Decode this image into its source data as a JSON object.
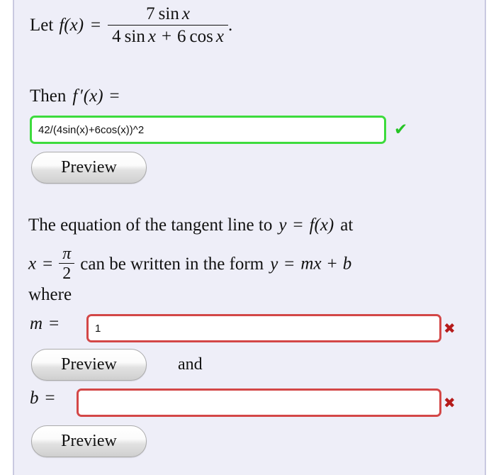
{
  "problem": {
    "intro_lead": "Let",
    "function_name": "f(x)",
    "equals": "=",
    "numerator_coefficient": "7",
    "numerator_func": "sin",
    "numerator_var": "x",
    "denominator": "4 sin x + 6 cos x",
    "den_c1": "4",
    "den_f1": "sin",
    "den_v1": "x",
    "den_plus": "+",
    "den_c2": "6",
    "den_f2": "cos",
    "den_v2": "x",
    "period": "."
  },
  "derivative_prompt": {
    "lead": "Then",
    "symbol": "f",
    "prime": "′",
    "arg": "(x)",
    "equals": "="
  },
  "answers": {
    "fprime": {
      "value": "42/(4sin(x)+6cos(x))^2",
      "placeholder": "",
      "status": "correct",
      "status_icon": "check-icon",
      "status_glyph": "✔"
    },
    "m": {
      "label_var": "m",
      "label_eq": "=",
      "value": "1",
      "placeholder": "",
      "status": "incorrect",
      "status_icon": "cross-icon",
      "status_glyph": "✖"
    },
    "b": {
      "label_var": "b",
      "label_eq": "=",
      "value": "",
      "placeholder": "",
      "status": "incorrect",
      "status_icon": "cross-icon",
      "status_glyph": "✖"
    }
  },
  "tangent": {
    "line1_a": "The equation of the tangent line to",
    "line1_y": "y",
    "line1_eq": "=",
    "line1_f": "f(x)",
    "line1_at": "at",
    "line2_x": "x",
    "line2_eq": "=",
    "frac_num": "π",
    "frac_den": "2",
    "line2_mid": "can be written in the form",
    "line2_y": "y",
    "line2_eq2": "=",
    "line2_m": "m",
    "line2_xv": "x",
    "line2_plus": "+",
    "line2_b": "b",
    "line3": "where"
  },
  "buttons": {
    "preview_fprime": "Preview",
    "preview_m": "Preview",
    "preview_b": "Preview",
    "conjunction": "and"
  },
  "colors": {
    "page_background": "#ffffff",
    "panel_background": "#eeeef8",
    "panel_rule": "#c9c9e0",
    "correct_border": "#3ddb3d",
    "incorrect_border": "#d34747",
    "check_mark": "#26c426",
    "cross_mark": "#b51a1a",
    "text": "#111111",
    "input_background": "#ffffff"
  }
}
